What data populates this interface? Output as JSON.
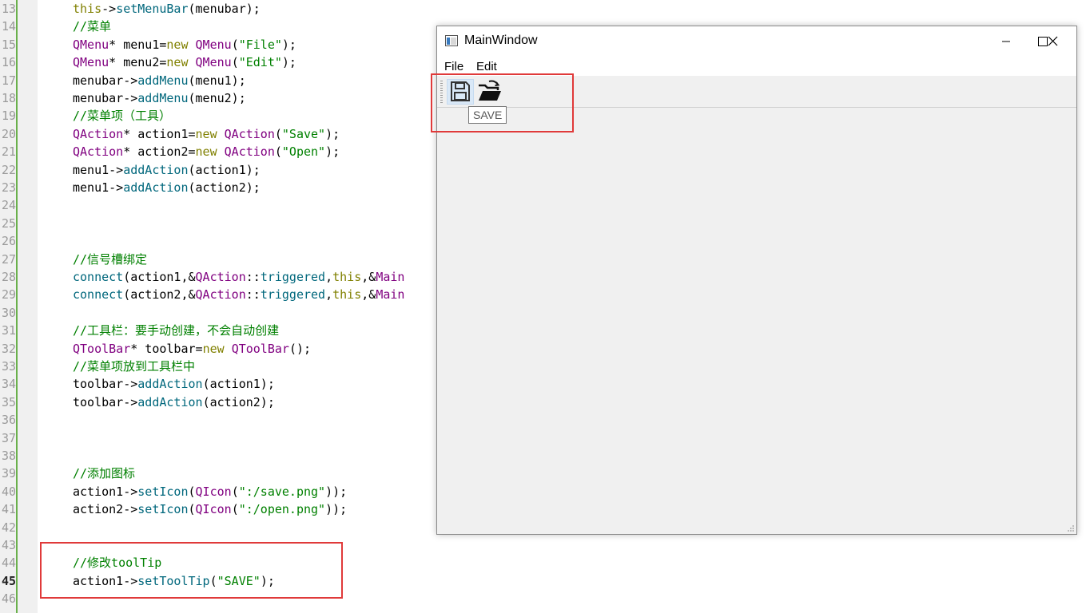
{
  "editor": {
    "current_line": 45,
    "line_numbers": [
      "13",
      "14",
      "15",
      "16",
      "17",
      "18",
      "19",
      "20",
      "21",
      "22",
      "23",
      "24",
      "25",
      "26",
      "27",
      "28",
      "29",
      "30",
      "31",
      "32",
      "33",
      "34",
      "35",
      "36",
      "37",
      "38",
      "39",
      "40",
      "41",
      "42",
      "43",
      "44",
      "45",
      "46"
    ],
    "lines": [
      [
        {
          "c": "kw",
          "t": "this"
        },
        {
          "c": "",
          "t": "->"
        },
        {
          "c": "fn",
          "t": "setMenuBar"
        },
        {
          "c": "",
          "t": "(menubar);"
        }
      ],
      [
        {
          "c": "cm",
          "t": "//菜单"
        }
      ],
      [
        {
          "c": "ty",
          "t": "QMenu"
        },
        {
          "c": "",
          "t": "* menu1="
        },
        {
          "c": "kw",
          "t": "new"
        },
        {
          "c": "",
          "t": " "
        },
        {
          "c": "ty",
          "t": "QMenu"
        },
        {
          "c": "",
          "t": "("
        },
        {
          "c": "st",
          "t": "\"File\""
        },
        {
          "c": "",
          "t": ");"
        }
      ],
      [
        {
          "c": "ty",
          "t": "QMenu"
        },
        {
          "c": "",
          "t": "* menu2="
        },
        {
          "c": "kw",
          "t": "new"
        },
        {
          "c": "",
          "t": " "
        },
        {
          "c": "ty",
          "t": "QMenu"
        },
        {
          "c": "",
          "t": "("
        },
        {
          "c": "st",
          "t": "\"Edit\""
        },
        {
          "c": "",
          "t": ");"
        }
      ],
      [
        {
          "c": "",
          "t": "menubar->"
        },
        {
          "c": "fn",
          "t": "addMenu"
        },
        {
          "c": "",
          "t": "(menu1);"
        }
      ],
      [
        {
          "c": "",
          "t": "menubar->"
        },
        {
          "c": "fn",
          "t": "addMenu"
        },
        {
          "c": "",
          "t": "(menu2);"
        }
      ],
      [
        {
          "c": "cm",
          "t": "//菜单项（工具）"
        }
      ],
      [
        {
          "c": "ty",
          "t": "QAction"
        },
        {
          "c": "",
          "t": "* action1="
        },
        {
          "c": "kw",
          "t": "new"
        },
        {
          "c": "",
          "t": " "
        },
        {
          "c": "ty",
          "t": "QAction"
        },
        {
          "c": "",
          "t": "("
        },
        {
          "c": "st",
          "t": "\"Save\""
        },
        {
          "c": "",
          "t": ");"
        }
      ],
      [
        {
          "c": "ty",
          "t": "QAction"
        },
        {
          "c": "",
          "t": "* action2="
        },
        {
          "c": "kw",
          "t": "new"
        },
        {
          "c": "",
          "t": " "
        },
        {
          "c": "ty",
          "t": "QAction"
        },
        {
          "c": "",
          "t": "("
        },
        {
          "c": "st",
          "t": "\"Open\""
        },
        {
          "c": "",
          "t": ");"
        }
      ],
      [
        {
          "c": "",
          "t": "menu1->"
        },
        {
          "c": "fn",
          "t": "addAction"
        },
        {
          "c": "",
          "t": "(action1);"
        }
      ],
      [
        {
          "c": "",
          "t": "menu1->"
        },
        {
          "c": "fn",
          "t": "addAction"
        },
        {
          "c": "",
          "t": "(action2);"
        }
      ],
      [],
      [],
      [],
      [
        {
          "c": "cm",
          "t": "//信号槽绑定"
        }
      ],
      [
        {
          "c": "fn",
          "t": "connect"
        },
        {
          "c": "",
          "t": "(action1,&"
        },
        {
          "c": "ty",
          "t": "QAction"
        },
        {
          "c": "",
          "t": "::"
        },
        {
          "c": "fn",
          "t": "triggered"
        },
        {
          "c": "",
          "t": ","
        },
        {
          "c": "kw",
          "t": "this"
        },
        {
          "c": "",
          "t": ",&"
        },
        {
          "c": "ty",
          "t": "Main"
        }
      ],
      [
        {
          "c": "fn",
          "t": "connect"
        },
        {
          "c": "",
          "t": "(action2,&"
        },
        {
          "c": "ty",
          "t": "QAction"
        },
        {
          "c": "",
          "t": "::"
        },
        {
          "c": "fn",
          "t": "triggered"
        },
        {
          "c": "",
          "t": ","
        },
        {
          "c": "kw",
          "t": "this"
        },
        {
          "c": "",
          "t": ",&"
        },
        {
          "c": "ty",
          "t": "Main"
        }
      ],
      [],
      [
        {
          "c": "cm",
          "t": "//工具栏：要手动创建，不会自动创建"
        }
      ],
      [
        {
          "c": "ty",
          "t": "QToolBar"
        },
        {
          "c": "",
          "t": "* toolbar="
        },
        {
          "c": "kw",
          "t": "new"
        },
        {
          "c": "",
          "t": " "
        },
        {
          "c": "ty",
          "t": "QToolBar"
        },
        {
          "c": "",
          "t": "();"
        }
      ],
      [
        {
          "c": "cm",
          "t": "//菜单项放到工具栏中"
        }
      ],
      [
        {
          "c": "",
          "t": "toolbar->"
        },
        {
          "c": "fn",
          "t": "addAction"
        },
        {
          "c": "",
          "t": "(action1);"
        }
      ],
      [
        {
          "c": "",
          "t": "toolbar->"
        },
        {
          "c": "fn",
          "t": "addAction"
        },
        {
          "c": "",
          "t": "(action2);"
        }
      ],
      [],
      [],
      [],
      [
        {
          "c": "cm",
          "t": "//添加图标"
        }
      ],
      [
        {
          "c": "",
          "t": "action1->"
        },
        {
          "c": "fn",
          "t": "setIcon"
        },
        {
          "c": "",
          "t": "("
        },
        {
          "c": "ty",
          "t": "QIcon"
        },
        {
          "c": "",
          "t": "("
        },
        {
          "c": "st",
          "t": "\":/save.png\""
        },
        {
          "c": "",
          "t": "));"
        }
      ],
      [
        {
          "c": "",
          "t": "action2->"
        },
        {
          "c": "fn",
          "t": "setIcon"
        },
        {
          "c": "",
          "t": "("
        },
        {
          "c": "ty",
          "t": "QIcon"
        },
        {
          "c": "",
          "t": "("
        },
        {
          "c": "st",
          "t": "\":/open.png\""
        },
        {
          "c": "",
          "t": "));"
        }
      ],
      [],
      [],
      [
        {
          "c": "cm",
          "t": "//修改toolTip"
        }
      ],
      [
        {
          "c": "",
          "t": "action1->"
        },
        {
          "c": "fn",
          "t": "setToolTip"
        },
        {
          "c": "",
          "t": "("
        },
        {
          "c": "st",
          "t": "\"SAVE\""
        },
        {
          "c": "",
          "t": ");"
        }
      ],
      []
    ]
  },
  "window": {
    "title": "MainWindow",
    "menu": {
      "file": "File",
      "edit": "Edit"
    },
    "toolbar": {
      "save_icon": "floppy-disk-icon",
      "open_icon": "open-folder-icon"
    },
    "tooltip": "SAVE"
  },
  "colors": {
    "highlight_box": "#e03a3a",
    "comment": "#008000",
    "type": "#800080",
    "keyword": "#808000",
    "function": "#00677c"
  }
}
